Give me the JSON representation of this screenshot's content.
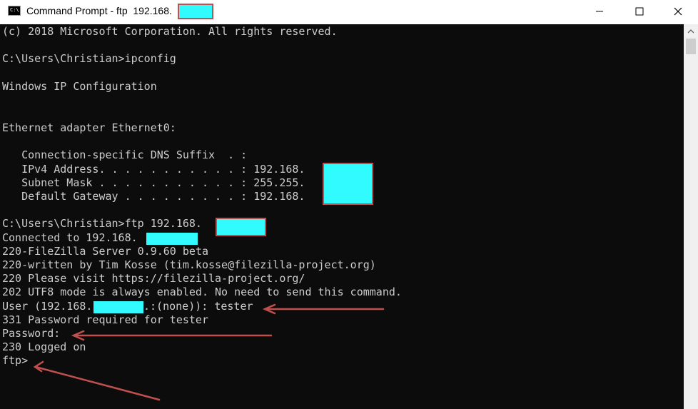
{
  "window": {
    "title": "Command Prompt - ftp  192.168.",
    "icon_label": "C:\\",
    "icon": "cmd-icon",
    "controls": [
      "minimize-icon",
      "maximize-icon",
      "close-icon"
    ]
  },
  "console": {
    "lines": [
      "(c) 2018 Microsoft Corporation. All rights reserved.",
      "",
      "C:\\Users\\Christian>ipconfig",
      "",
      "Windows IP Configuration",
      "",
      "",
      "Ethernet adapter Ethernet0:",
      "",
      "   Connection-specific DNS Suffix  . :",
      "   IPv4 Address. . . . . . . . . . . : 192.168.",
      "   Subnet Mask . . . . . . . . . . . : 255.255.",
      "   Default Gateway . . . . . . . . . : 192.168.",
      "",
      "C:\\Users\\Christian>ftp 192.168.",
      "Connected to 192.168.",
      "220-FileZilla Server 0.9.60 beta",
      "220-written by Tim Kosse (tim.kosse@filezilla-project.org)",
      "220 Please visit https://filezilla-project.org/",
      "202 UTF8 mode is always enabled. No need to send this command.",
      "User (192.168.",
      "331 Password required for tester",
      "Password:",
      "230 Logged on",
      "ftp>"
    ],
    "user_line_suffix": ".:(none)): tester"
  },
  "colors": {
    "console_bg": "#0c0c0c",
    "console_text": "#cccccc",
    "redaction_fill": "#31fbff",
    "annotation_red": "#c0504d"
  }
}
